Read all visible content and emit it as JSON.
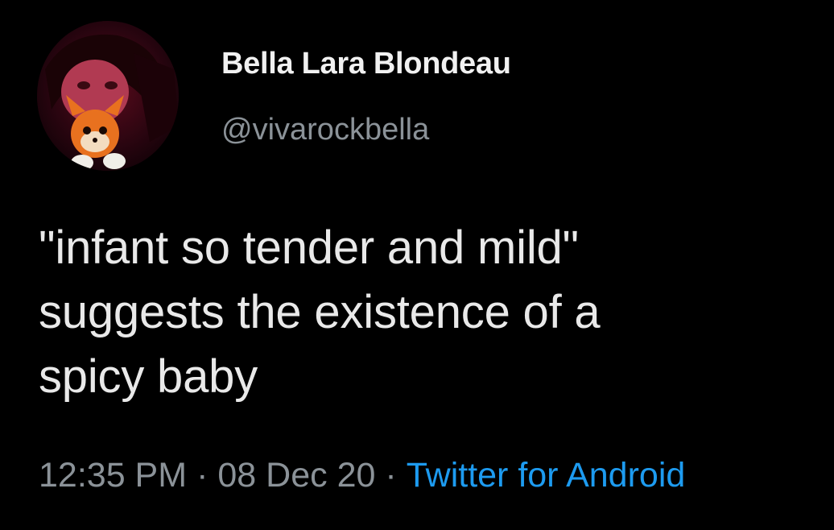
{
  "author": {
    "display_name": "Bella Lara Blondeau",
    "handle": "@vivarockbella",
    "avatar_icon": "profile-photo"
  },
  "tweet": {
    "lines": [
      "\"infant so tender and mild\"",
      "suggests the existence of a",
      "spicy baby"
    ]
  },
  "meta": {
    "time": "12:35 PM",
    "separator": "·",
    "date": "08 Dec 20",
    "source": "Twitter for Android"
  },
  "colors": {
    "background": "#000000",
    "text": "#e9e9e9",
    "muted": "#8b9298",
    "link": "#1d9bf0"
  }
}
